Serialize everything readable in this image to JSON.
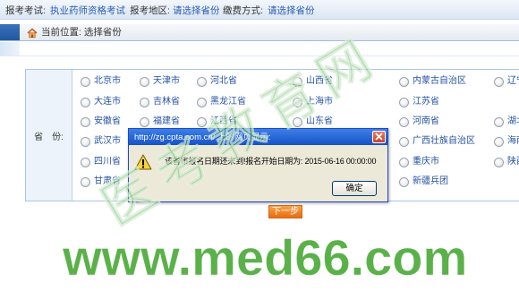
{
  "header": {
    "exam_label": "报考考试:",
    "exam_value": "执业药师资格考试",
    "region_label": "报考地区:",
    "region_value": "请选择省份",
    "payment_label": "缴费方式:",
    "payment_value": "请选择省份"
  },
  "breadcrumb": {
    "text": "当前位置: 选择省份"
  },
  "province_table": {
    "label": "省　份:",
    "rows": [
      [
        "北京市",
        "天津市",
        "河北省",
        "山西省",
        "内蒙古自治区",
        "辽宁"
      ],
      [
        "大连市",
        "吉林省",
        "黑龙江省",
        "上海市",
        "江苏省"
      ],
      [
        "安徽省",
        "福建省",
        "江西省",
        "山东省",
        "河南省",
        "湖北"
      ],
      [
        "武汉市",
        "广西壮族自治区",
        "海南"
      ],
      [
        "四川省",
        "重庆市",
        "陕西"
      ],
      [
        "甘肃省",
        "新疆兵团"
      ]
    ]
  },
  "form": {
    "next_label": "下一步"
  },
  "dialog": {
    "title": "http://zg.cpta.com.cn/ 上的网页显示:",
    "message": "该省市报名日期还未到!报名开始日期为: 2015-06-16 00:00:00",
    "ok_label": "确定"
  },
  "watermarks": {
    "site_name": "医考教育网",
    "url": "www.med66.com"
  },
  "icons": {
    "home": "home-icon",
    "warning": "warning-icon",
    "close": "close-icon"
  },
  "colors": {
    "link_blue": "#2a5cb0",
    "title_bar_blue": "#1652c6",
    "next_button_orange": "#ee7a1e",
    "dialog_background": "#ece9d8",
    "watermark_green": "#4dab3a"
  }
}
